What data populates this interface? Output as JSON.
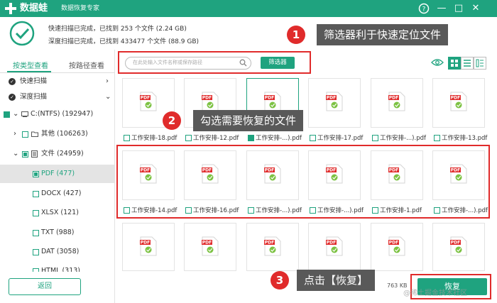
{
  "titlebar": {
    "app_name": "数据蛙",
    "app_subtitle": "数据恢复专家",
    "help_icon": "?",
    "minimize_icon": "—",
    "maximize_icon": "□",
    "close_icon": "✕"
  },
  "status": {
    "quick_scan": "快速扫描已完成，已找到  253 个文件 (2.24 GB)",
    "deep_scan": "深度扫描已完成，已找到  433477 个文件 (88.9 GB)"
  },
  "sidebar": {
    "tab_by_type": "按类型查看",
    "tab_by_path": "按路径查看",
    "quick_scan": "快速扫描",
    "deep_scan": "深度扫描",
    "drive": "C:(NTFS) (192947)",
    "other": "其他 (106263)",
    "file": "文件 (24959)",
    "types": [
      {
        "label": "PDF (477)"
      },
      {
        "label": "DOCX (427)"
      },
      {
        "label": "XLSX (121)"
      },
      {
        "label": "TXT (988)"
      },
      {
        "label": "DAT (3058)"
      },
      {
        "label": "HTML (313)"
      }
    ],
    "back_button": "返回"
  },
  "toolbar": {
    "search_placeholder": "在此处输入文件名称或保存路径",
    "filter_button": "筛选器"
  },
  "files": {
    "row1": [
      "工作安排-18.pdf",
      "工作安排-12.pdf",
      "工作安排-...).pdf",
      "工作安排-17.pdf",
      "工作安排-...).pdf",
      "工作安排-13.pdf"
    ],
    "row2": [
      "工作安排-14.pdf",
      "工作安排-16.pdf",
      "工作安排-...).pdf",
      "工作安排-...).pdf",
      "工作安排-1.pdf",
      "工作安排-...).pdf"
    ],
    "pdf_label": "PDF"
  },
  "bottom": {
    "size_text": "763 KB",
    "recover_button": "恢复"
  },
  "annotations": [
    {
      "number": "1",
      "text": "筛选器利于快速定位文件"
    },
    {
      "number": "2",
      "text": "勾选需要恢复的文件"
    },
    {
      "number": "3",
      "text": "点击【恢复】"
    }
  ],
  "watermark": "@稀土掘金技术社区",
  "colors": {
    "accent": "#1fa37f",
    "annotation_red": "#e02b2b",
    "callout_gray": "#595959"
  }
}
